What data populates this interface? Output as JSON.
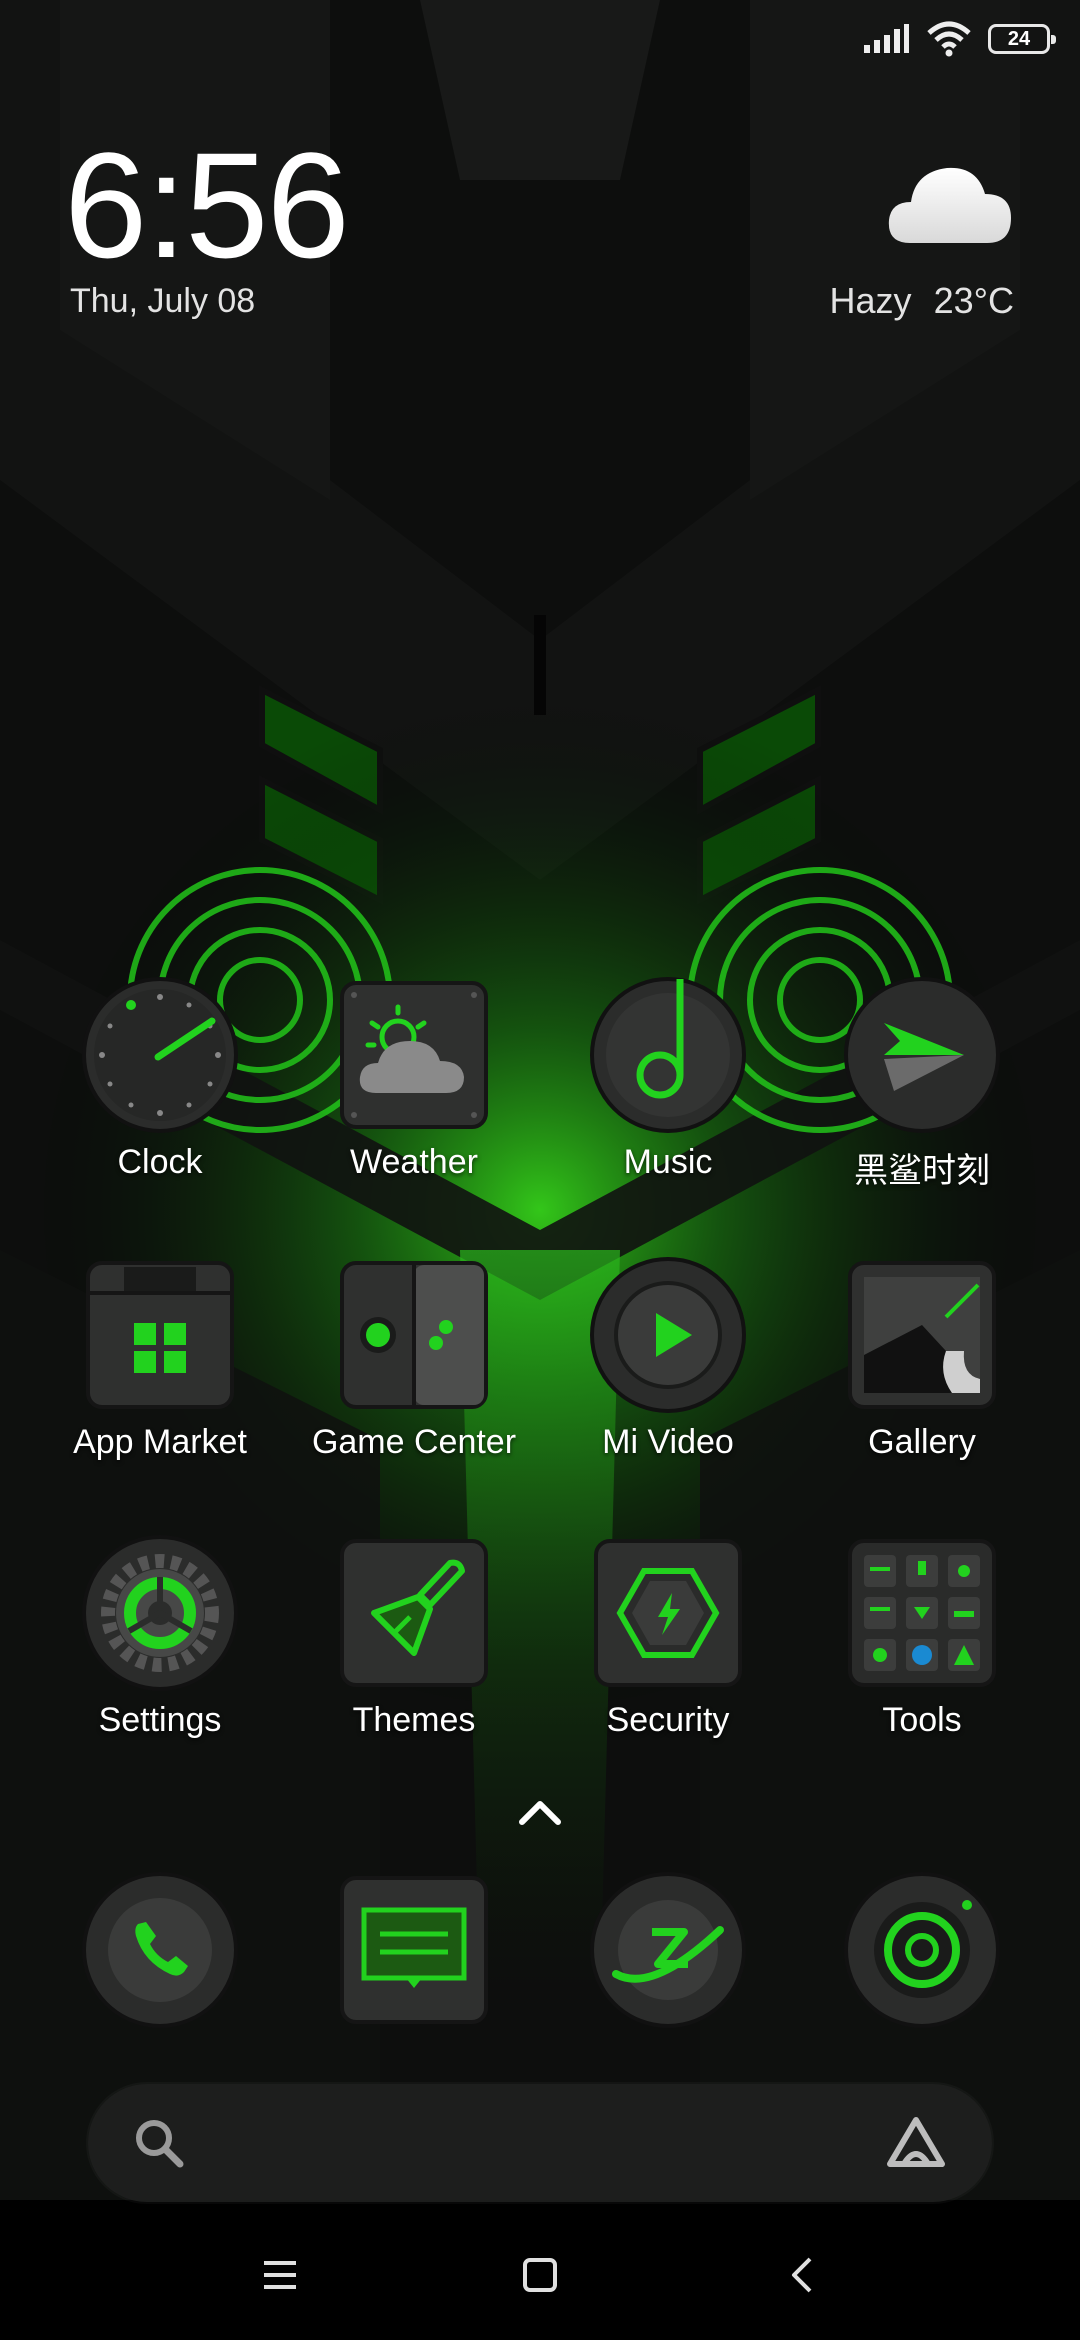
{
  "status_bar": {
    "battery_level": "24",
    "icons": [
      "signal-icon",
      "wifi-icon",
      "battery-icon"
    ]
  },
  "widget": {
    "time": "6:56",
    "date": "Thu, July 08",
    "weather_condition": "Hazy",
    "temperature": "23°C",
    "weather_icon": "cloud-icon"
  },
  "apps": [
    {
      "label": "Clock",
      "icon": "clock-icon"
    },
    {
      "label": "Weather",
      "icon": "weather-icon"
    },
    {
      "label": "Music",
      "icon": "music-icon"
    },
    {
      "label": "黑鲨时刻",
      "icon": "blackshark-moment-icon"
    },
    {
      "label": "App Market",
      "icon": "app-market-icon"
    },
    {
      "label": "Game Center",
      "icon": "game-center-icon"
    },
    {
      "label": "Mi Video",
      "icon": "mi-video-icon"
    },
    {
      "label": "Gallery",
      "icon": "gallery-icon"
    },
    {
      "label": "Settings",
      "icon": "settings-icon"
    },
    {
      "label": "Themes",
      "icon": "themes-icon"
    },
    {
      "label": "Security",
      "icon": "security-icon"
    },
    {
      "label": "Tools",
      "icon": "tools-folder-icon"
    }
  ],
  "dock": [
    "phone-icon",
    "messages-icon",
    "browser-icon",
    "camera-icon"
  ],
  "search": {
    "placeholder": ""
  },
  "nav": [
    "menu-icon",
    "home-icon",
    "back-icon"
  ],
  "colors": {
    "accent": "#22d21e",
    "background": "#0b0c0b",
    "icon_base": "#2c2d2c"
  }
}
